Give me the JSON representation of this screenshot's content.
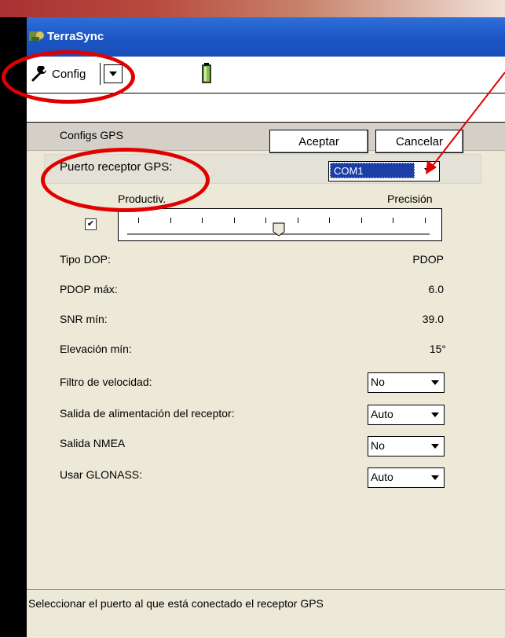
{
  "app": {
    "title": "TerraSync"
  },
  "toolbar": {
    "config_label": "Config"
  },
  "panel": {
    "section_title": "Configs GPS",
    "accept_label": "Aceptar",
    "cancel_label": "Cancelar",
    "port": {
      "label": "Puerto receptor GPS:",
      "value": "COM1"
    },
    "slider": {
      "left_label": "Productiv.",
      "right_label": "Precisión",
      "checked": true,
      "position_fraction": 0.5
    },
    "fields": [
      {
        "label": "Tipo DOP:",
        "value": "PDOP"
      },
      {
        "label": "PDOP máx:",
        "value": "6.0"
      },
      {
        "label": "SNR mín:",
        "value": "39.0"
      },
      {
        "label": "Elevación mín:",
        "value": "15°"
      }
    ],
    "dropdowns": [
      {
        "label": "Filtro de velocidad:",
        "value": "No"
      },
      {
        "label": "Salida de alimentación del receptor:",
        "value": "Auto"
      },
      {
        "label": "Salida NMEA",
        "value": "No"
      },
      {
        "label": "Usar GLONASS:",
        "value": "Auto"
      }
    ]
  },
  "status": {
    "text": "Seleccionar el puerto al que está conectado el receptor GPS"
  },
  "colors": {
    "title_bar": "#1b55c4",
    "annotation": "#e10000",
    "selection": "#1c3fa6",
    "panel": "#ece9d8"
  }
}
